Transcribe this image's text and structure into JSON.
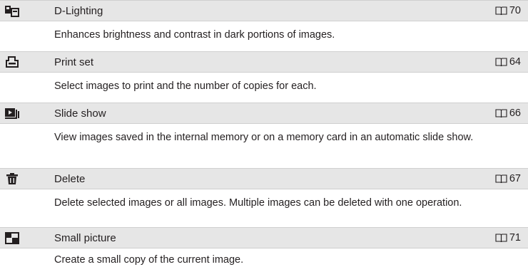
{
  "items": [
    {
      "icon": "d-lighting-icon",
      "title": "D-Lighting",
      "page": "70",
      "description": "Enhances brightness and contrast in dark portions of images."
    },
    {
      "icon": "print-set-icon",
      "title": "Print set",
      "page": "64",
      "description": "Select images to print and the number of copies for each."
    },
    {
      "icon": "slide-show-icon",
      "title": "Slide show",
      "page": "66",
      "description": "View images saved in the internal memory or on a memory card in an automatic slide show."
    },
    {
      "icon": "delete-icon",
      "title": "Delete",
      "page": "67",
      "description": "Delete selected images or all images. Multiple images can be deleted with one operation."
    },
    {
      "icon": "small-picture-icon",
      "title": "Small picture",
      "page": "71",
      "description": "Create a small copy of the current image."
    }
  ]
}
